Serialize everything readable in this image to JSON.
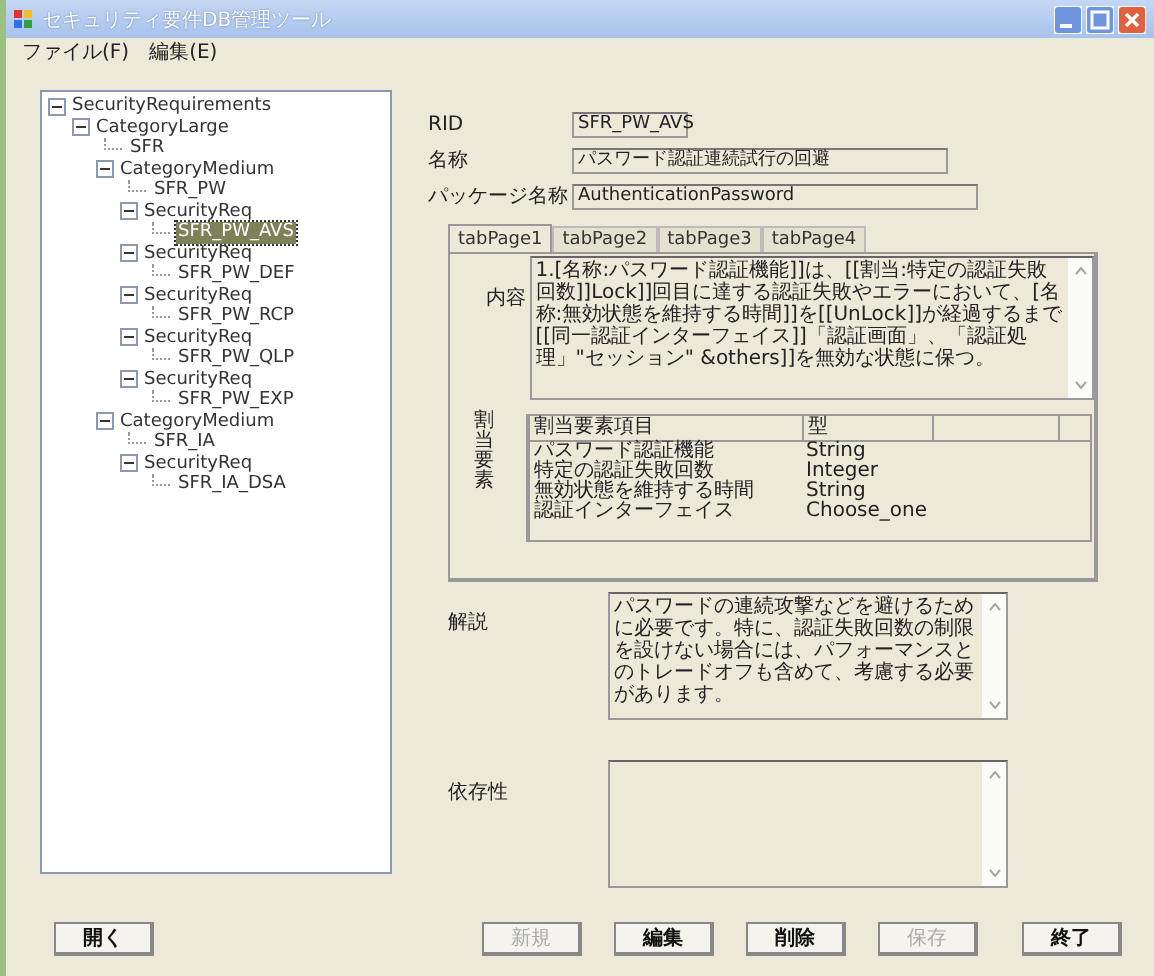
{
  "window": {
    "title": "セキュリティ要件DB管理ツール"
  },
  "menu": [
    "ファイル(F)",
    "編集(E)"
  ],
  "tree": [
    {
      "label": "SecurityRequirements",
      "expanded": true,
      "selected": false,
      "children": [
        {
          "label": "CategoryLarge",
          "expanded": true,
          "selected": false,
          "children": [
            {
              "label": "SFR",
              "selected": false
            },
            {
              "label": "CategoryMedium",
              "expanded": true,
              "selected": false,
              "children": [
                {
                  "label": "SFR_PW",
                  "selected": false
                },
                {
                  "label": "SecurityReq",
                  "expanded": true,
                  "selected": false,
                  "children": [
                    {
                      "label": "SFR_PW_AVS",
                      "selected": true
                    }
                  ]
                },
                {
                  "label": "SecurityReq",
                  "expanded": true,
                  "selected": false,
                  "children": [
                    {
                      "label": "SFR_PW_DEF",
                      "selected": false
                    }
                  ]
                },
                {
                  "label": "SecurityReq",
                  "expanded": true,
                  "selected": false,
                  "children": [
                    {
                      "label": "SFR_PW_RCP",
                      "selected": false
                    }
                  ]
                },
                {
                  "label": "SecurityReq",
                  "expanded": true,
                  "selected": false,
                  "children": [
                    {
                      "label": "SFR_PW_QLP",
                      "selected": false
                    }
                  ]
                },
                {
                  "label": "SecurityReq",
                  "expanded": true,
                  "selected": false,
                  "children": [
                    {
                      "label": "SFR_PW_EXP",
                      "selected": false
                    }
                  ]
                }
              ]
            },
            {
              "label": "CategoryMedium",
              "expanded": true,
              "selected": false,
              "children": [
                {
                  "label": "SFR_IA",
                  "selected": false
                },
                {
                  "label": "SecurityReq",
                  "expanded": true,
                  "selected": false,
                  "children": [
                    {
                      "label": "SFR_IA_DSA",
                      "selected": false
                    }
                  ]
                }
              ]
            }
          ]
        }
      ]
    }
  ],
  "fields": [
    {
      "label": "RID",
      "value": "SFR_PW_AVS",
      "kind": "short"
    },
    {
      "label": "名称",
      "value": "パスワード認証連続試行の回避",
      "kind": "medium"
    },
    {
      "label": "パッケージ名称",
      "value": "AuthenticationPassword",
      "kind": "long"
    }
  ],
  "tabs": [
    {
      "label": "tabPage1",
      "selected": true
    },
    {
      "label": "tabPage2",
      "selected": false
    },
    {
      "label": "tabPage3",
      "selected": false
    },
    {
      "label": "tabPage4",
      "selected": false
    }
  ],
  "content": {
    "label": "内容",
    "value": "1.[名称:パスワード認証機能]]は、[[割当:特定の認証失敗回数]]Lock]]回目に達する認証失敗やエラーにおいて、[名称:無効状態を維持する時間]]を[[UnLock]]が経過するまで[[同一認証インターフェイス]]「認証画面」、「認証処理」\"セッション\" &others]]を無効な状態に保つ。"
  },
  "assignment": {
    "label": "割当要素",
    "columns": [
      "割当要素項目",
      "型"
    ],
    "rows": [
      [
        "パスワード認証機能",
        "String"
      ],
      [
        "特定の認証失敗回数",
        "Integer"
      ],
      [
        "無効状態を維持する時間",
        "String"
      ],
      [
        "認証インターフェイス",
        "Choose_one"
      ]
    ]
  },
  "explanation": {
    "label": "解説",
    "value": "パスワードの連続攻撃などを避けるために必要です。特に、認証失敗回数の制限を設けない場合には、パフォーマンスとのトレードオフも含めて、考慮する必要があります。"
  },
  "dependency": {
    "label": "依存性"
  },
  "open_button": {
    "label": "開く",
    "disabled": false
  },
  "buttons": [
    {
      "label": "新規",
      "disabled": true
    },
    {
      "label": "編集",
      "disabled": false
    },
    {
      "label": "削除",
      "disabled": false
    },
    {
      "label": "保存",
      "disabled": true
    },
    {
      "label": "終了",
      "disabled": false
    }
  ]
}
